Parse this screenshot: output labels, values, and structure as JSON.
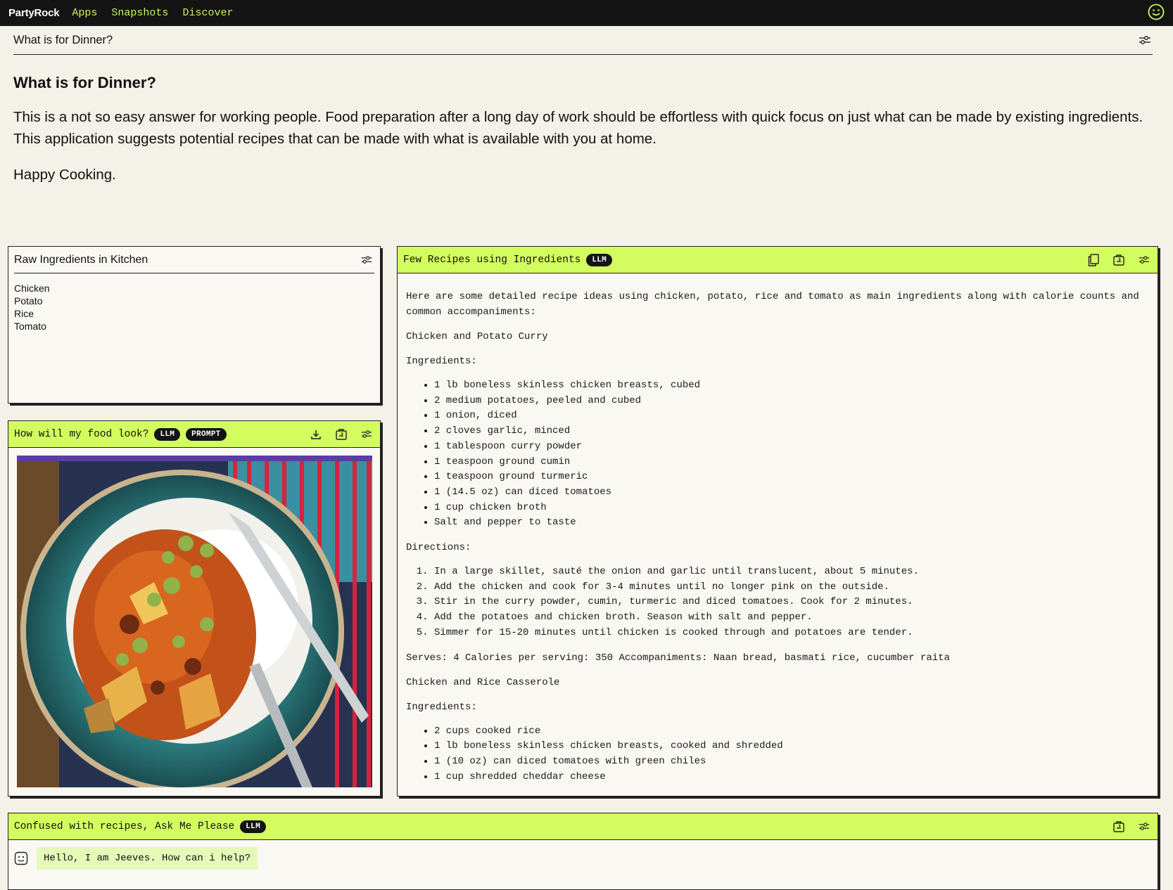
{
  "nav": {
    "brand": "PartyRock",
    "links": [
      "Apps",
      "Snapshots",
      "Discover"
    ],
    "avatar_icon": "smiley-face-icon"
  },
  "app": {
    "title": "What is for Dinner?"
  },
  "intro": {
    "heading": "What is for Dinner?",
    "paragraph": "This is a not so easy answer for working people. Food preparation after a long day of work should be effortless with quick focus on just what can be made by existing ingredients. This application suggests potential recipes that can be made with what is available with you at home.",
    "closing": "Happy Cooking."
  },
  "raw_widget": {
    "title": "Raw Ingredients in Kitchen",
    "items": [
      "Chicken",
      "Potato",
      "Rice",
      "Tomato"
    ]
  },
  "image_widget": {
    "title": "How will my food look?",
    "badges": [
      "LLM",
      "PROMPT"
    ]
  },
  "recipe_widget": {
    "title": "Few Recipes using Ingredients",
    "badge": "LLM",
    "intro": "Here are some detailed recipe ideas using chicken, potato, rice and tomato as main ingredients along with calorie counts and common accompaniments:",
    "recipe1_title": "Chicken and Potato Curry",
    "ingredients_label": "Ingredients:",
    "recipe1_ingredients": [
      "1 lb boneless skinless chicken breasts, cubed",
      "2 medium potatoes, peeled and cubed",
      "1 onion, diced",
      "2 cloves garlic, minced",
      "1 tablespoon curry powder",
      "1 teaspoon ground cumin",
      "1 teaspoon ground turmeric",
      "1 (14.5 oz) can diced tomatoes",
      "1 cup chicken broth",
      "Salt and pepper to taste"
    ],
    "directions_label": "Directions:",
    "recipe1_directions": [
      "In a large skillet, sauté the onion and garlic until translucent, about 5 minutes.",
      "Add the chicken and cook for 3-4 minutes until no longer pink on the outside.",
      "Stir in the curry powder, cumin, turmeric and diced tomatoes. Cook for 2 minutes.",
      "Add the potatoes and chicken broth. Season with salt and pepper.",
      "Simmer for 15-20 minutes until chicken is cooked through and potatoes are tender."
    ],
    "recipe1_serves": "Serves: 4 Calories per serving: 350 Accompaniments: Naan bread, basmati rice, cucumber raita",
    "recipe2_title": "Chicken and Rice Casserole",
    "ingredients_label2": "Ingredients:",
    "recipe2_ingredients": [
      "2 cups cooked rice",
      "1 lb boneless skinless chicken breasts, cooked and shredded",
      "1 (10 oz) can diced tomatoes with green chiles",
      "1 cup shredded cheddar cheese"
    ]
  },
  "chat_widget": {
    "title": "Confused with recipes, Ask Me Please",
    "badge": "LLM",
    "message": "Hello, I am Jeeves. How can i help?"
  },
  "colors": {
    "accent_lime": "#d3fd5e",
    "nav_bg": "#141414",
    "page_bg": "#f3f1e8"
  }
}
